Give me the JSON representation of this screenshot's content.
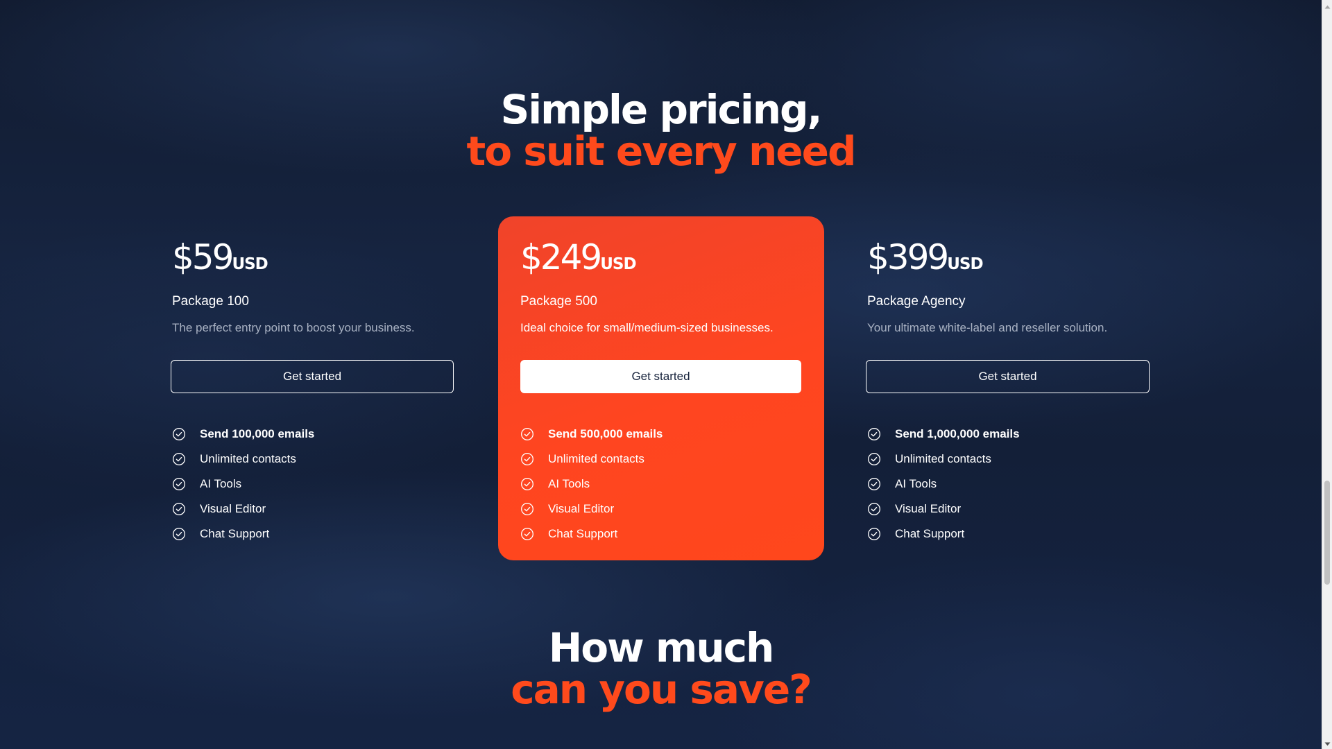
{
  "pricing_heading": {
    "line1": "Simple pricing,",
    "line2": "to suit every need"
  },
  "plans": [
    {
      "price": "$59",
      "currency": "USD",
      "name": "Package 100",
      "description": "The perfect entry point to boost your business.",
      "cta": "Get started",
      "features": [
        "Send 100,000 emails",
        "Unlimited contacts",
        "AI Tools",
        "Visual Editor",
        "Chat Support"
      ]
    },
    {
      "price": "$249",
      "currency": "USD",
      "name": "Package 500",
      "description": "Ideal choice for small/medium-sized businesses.",
      "cta": "Get started",
      "features": [
        "Send 500,000 emails",
        "Unlimited contacts",
        "AI Tools",
        "Visual Editor",
        "Chat Support"
      ]
    },
    {
      "price": "$399",
      "currency": "USD",
      "name": "Package Agency",
      "description": "Your ultimate white-label and reseller solution.",
      "cta": "Get started",
      "features": [
        "Send 1,000,000 emails",
        "Unlimited contacts",
        "AI Tools",
        "Visual Editor",
        "Chat Support"
      ]
    }
  ],
  "savings_heading": {
    "line1": "How much",
    "line2": "can you save?"
  },
  "icons": {
    "feature": "check-circle-icon",
    "scroll_up": "triangle-up-icon",
    "scroll_down": "triangle-down-icon"
  },
  "colors": {
    "accent": "#ff4a1c",
    "background": "#131f38",
    "text": "#ffffff",
    "muted_text": "#a9b2c3"
  }
}
